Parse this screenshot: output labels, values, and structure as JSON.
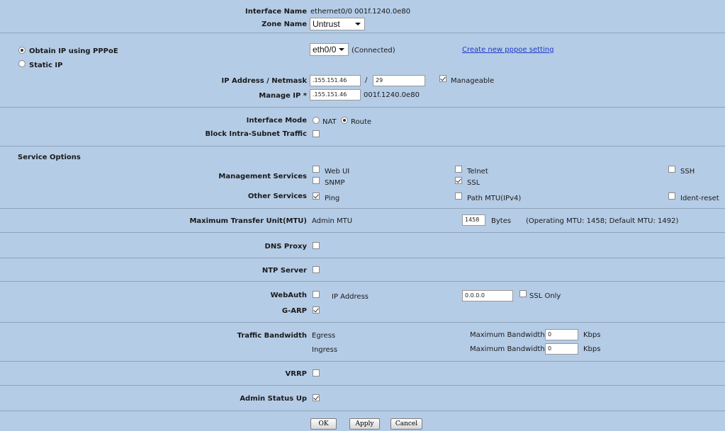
{
  "interface": {
    "name_label": "Interface Name",
    "name_value": "ethernet0/0 001f.1240.0e80",
    "zone_label": "Zone Name",
    "zone_value": "Untrust"
  },
  "ip_mode": {
    "pppoe_label": "Obtain IP using PPPoE",
    "static_label": "Static IP",
    "pppoe_selected": true,
    "eth_value": "eth0/0",
    "connection_status": "(Connected)",
    "create_link": "Create new pppoe setting"
  },
  "ip": {
    "address_label": "IP Address / Netmask",
    "address_value": ".155.151.46",
    "slash": "/",
    "netmask_value": "29",
    "manageable_label": "Manageable",
    "manageable_checked": true,
    "manage_ip_label": "Manage IP *",
    "manage_ip_value": ".155.151.46",
    "manage_mac": "001f.1240.0e80"
  },
  "interface_mode": {
    "label": "Interface Mode",
    "nat_label": "NAT",
    "route_label": "Route",
    "selected": "Route",
    "block_label": "Block Intra-Subnet Traffic"
  },
  "service_options": {
    "heading": "Service Options",
    "management_label": "Management Services",
    "other_label": "Other Services",
    "items": {
      "web_ui": {
        "label": "Web UI",
        "checked": false
      },
      "telnet": {
        "label": "Telnet",
        "checked": false
      },
      "ssh": {
        "label": "SSH",
        "checked": false
      },
      "snmp": {
        "label": "SNMP",
        "checked": false
      },
      "ssl": {
        "label": "SSL",
        "checked": true
      },
      "ping": {
        "label": "Ping",
        "checked": true
      },
      "path_mtu": {
        "label": "Path MTU(IPv4)",
        "checked": false
      },
      "ident_reset": {
        "label": "Ident-reset",
        "checked": false
      }
    }
  },
  "mtu": {
    "label": "Maximum Transfer Unit(MTU)",
    "admin_label": "Admin MTU",
    "value": "1458",
    "unit": "Bytes",
    "info": "(Operating MTU: 1458; Default MTU: 1492)"
  },
  "dns_proxy": {
    "label": "DNS Proxy"
  },
  "ntp_server": {
    "label": "NTP Server"
  },
  "webauth": {
    "label": "WebAuth",
    "ip_label": "IP Address",
    "ip_value": "0.0.0.0",
    "ssl_only_label": "SSL Only"
  },
  "garp": {
    "label": "G-ARP",
    "checked": true
  },
  "bandwidth": {
    "label": "Traffic Bandwidth",
    "egress_label": "Egress",
    "ingress_label": "Ingress",
    "max_label": "Maximum Bandwidth",
    "egress_value": "0",
    "ingress_value": "0",
    "unit": "Kbps"
  },
  "vrrp": {
    "label": "VRRP"
  },
  "admin_status": {
    "label": "Admin Status Up",
    "checked": true
  },
  "buttons": {
    "ok": "OK",
    "apply": "Apply",
    "cancel": "Cancel"
  }
}
